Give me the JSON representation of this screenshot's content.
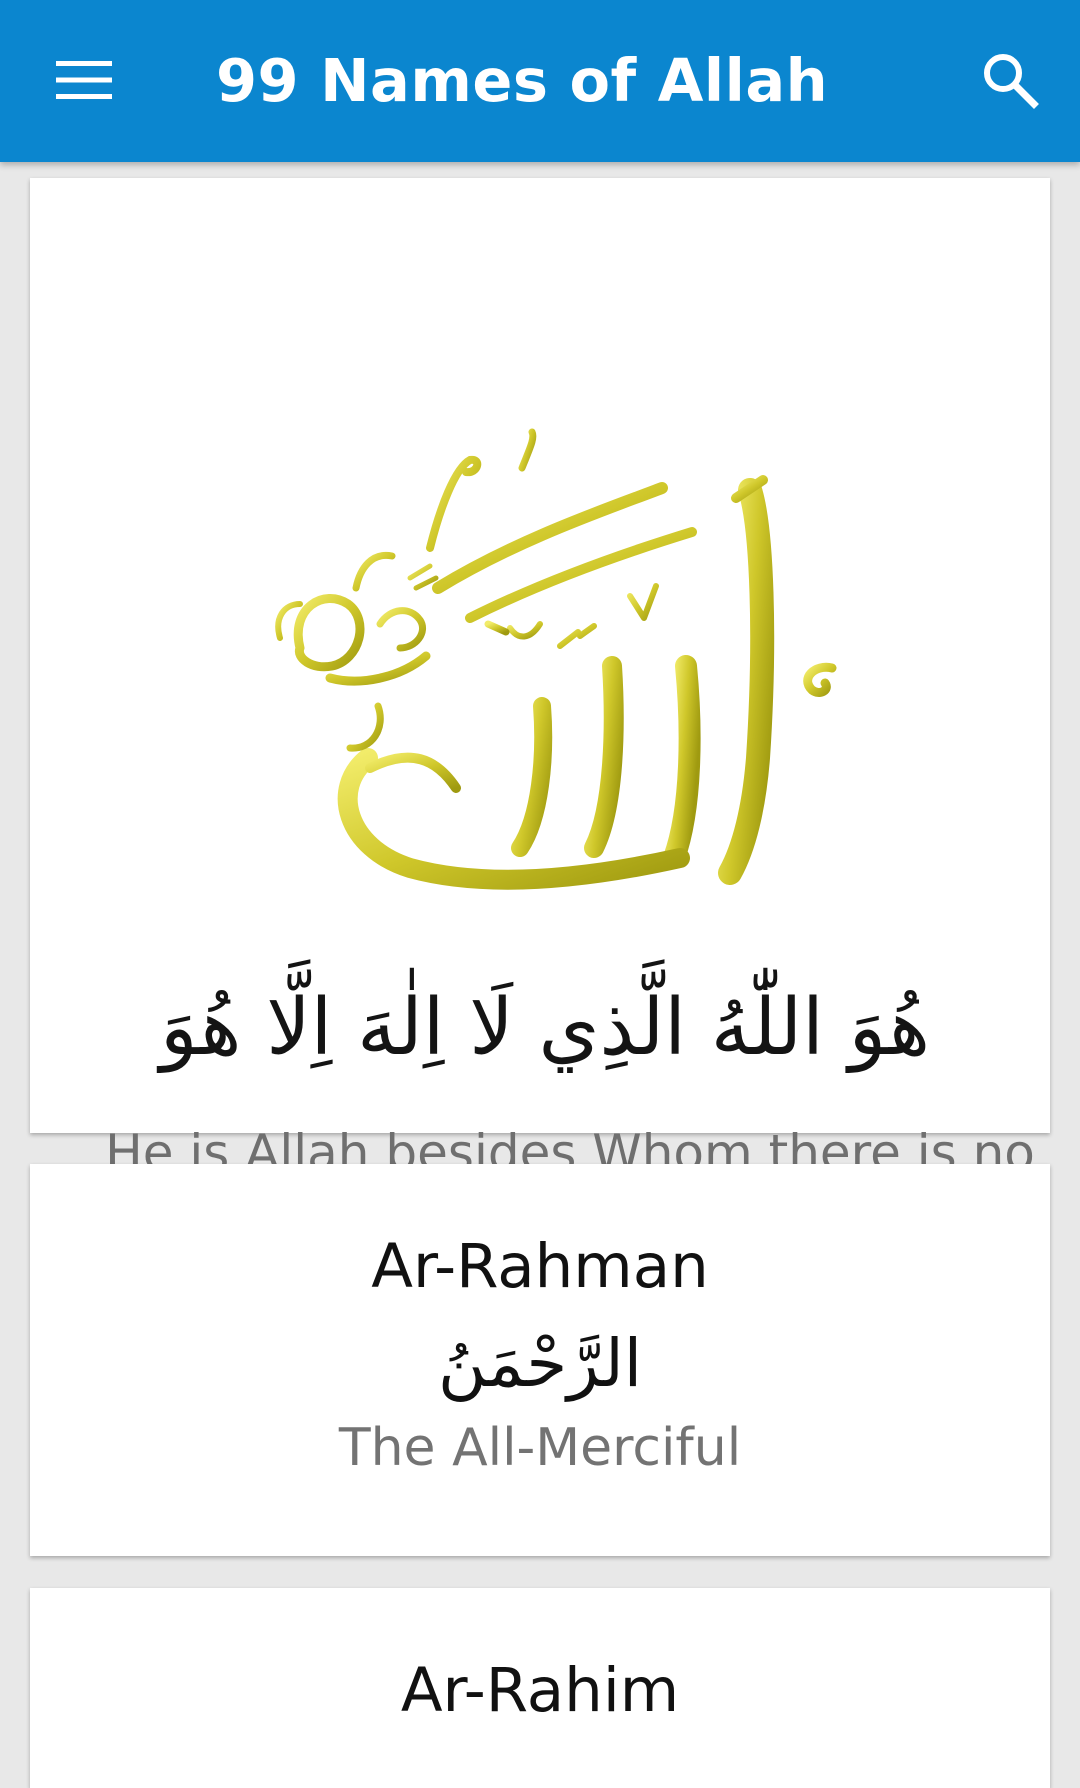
{
  "app_bar": {
    "title": "99 Names of Allah",
    "menu_icon": "hamburger-menu-icon",
    "search_icon": "search-icon",
    "background_color": "#0b86cf",
    "title_color": "#ffffff"
  },
  "hero": {
    "calligraphy_image": "allah-calligraphy-logo",
    "calligraphy_color": "#d6cf38",
    "arabic_verse": "هُوَ اللّٰهُ الَّذِي لَا اِلٰهَ اِلَّا هُوَ",
    "english_caption": "He is Allah besides Whom there is no god"
  },
  "names": [
    {
      "transliteration": "Ar-Rahman",
      "arabic": "الرَّحْمَنُ",
      "meaning": "The All-Merciful"
    },
    {
      "transliteration": "Ar-Rahim"
    }
  ],
  "colors": {
    "page_background": "#e8e8e8",
    "card_background": "#ffffff",
    "caption_text": "#6f6f6f"
  }
}
